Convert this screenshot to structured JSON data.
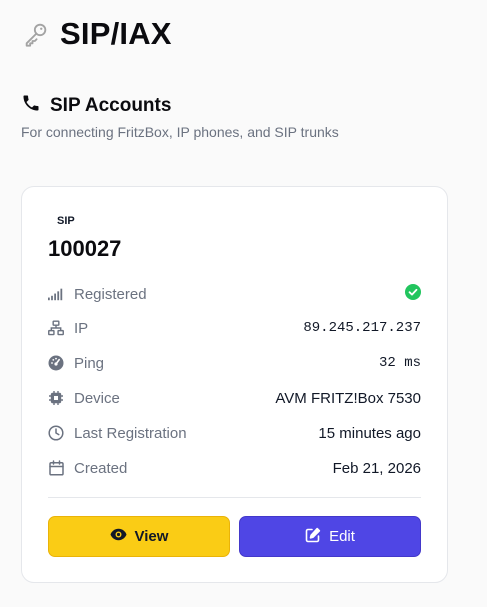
{
  "page": {
    "title": "SIP/IAX",
    "icon": "key-icon"
  },
  "section": {
    "title": "SIP Accounts",
    "subtitle": "For connecting FritzBox, IP phones, and SIP trunks",
    "icon": "phone-icon"
  },
  "account": {
    "type": "SIP",
    "number": "100027",
    "rows": [
      {
        "label": "Registered",
        "value": "",
        "status": "registered",
        "icon": "signal-icon"
      },
      {
        "label": "IP",
        "value": "89.245.217.237",
        "icon": "network-icon"
      },
      {
        "label": "Ping",
        "value": "32 ms",
        "icon": "gauge-icon"
      },
      {
        "label": "Device",
        "value": "AVM FRITZ!Box 7530",
        "icon": "chip-icon"
      },
      {
        "label": "Last Registration",
        "value": "15 minutes ago",
        "icon": "clock-icon"
      },
      {
        "label": "Created",
        "value": "Feb 21, 2026",
        "icon": "calendar-icon"
      }
    ],
    "actions": {
      "view_label": "View",
      "edit_label": "Edit"
    }
  },
  "colors": {
    "status_ok": "#22c55e",
    "view_button": "#facc15",
    "edit_button": "#4f46e5"
  }
}
